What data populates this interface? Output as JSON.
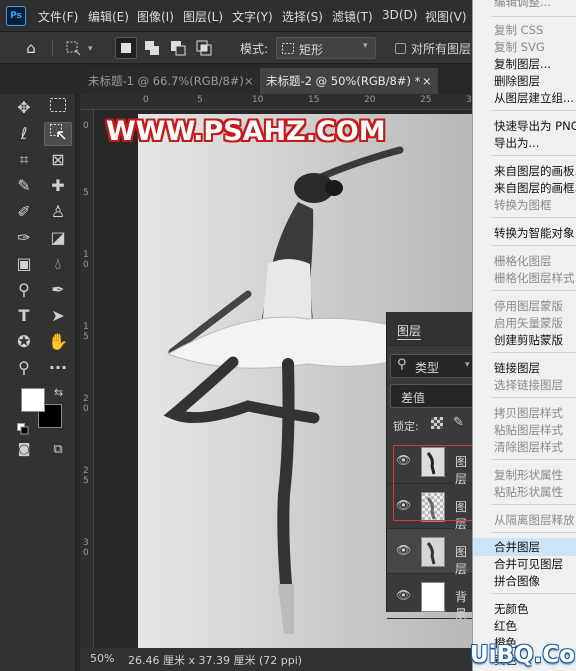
{
  "app": {
    "logo": "Ps"
  },
  "menubar": [
    "文件(F)",
    "编辑(E)",
    "图像(I)",
    "图层(L)",
    "文字(Y)",
    "选择(S)",
    "滤镜(T)",
    "3D(D)",
    "视图(V)"
  ],
  "options": {
    "mode_label": "模式:",
    "mode_value": "矩形",
    "align_label": "对所有图层"
  },
  "tabs": [
    {
      "label": "未标题-1 @ 66.7%(RGB/8#)"
    },
    {
      "label": "未标题-2 @ 50%(RGB/8#) *"
    }
  ],
  "watermark": "WWW.PSAHZ.COM",
  "ruler_h": [
    "0",
    "5",
    "10",
    "15",
    "20",
    "25",
    "3"
  ],
  "ruler_v": [
    "0",
    "5",
    "1\n0",
    "1\n5",
    "2\n0",
    "2\n5",
    "3\n0"
  ],
  "status": {
    "zoom": "50%",
    "info": "26.46 厘米 x 37.39 厘米 (72 ppi)"
  },
  "layers": {
    "title": "图层",
    "filter": "类型",
    "blend": "差值",
    "lock_label": "锁定:",
    "rows": [
      "图层",
      "图层",
      "图层",
      "背景"
    ]
  },
  "context_menu": {
    "items": [
      {
        "label": "编辑调整...",
        "disabled": true
      },
      {
        "label": "复制 CSS",
        "disabled": true
      },
      {
        "label": "复制 SVG",
        "disabled": true
      },
      {
        "label": "复制图层...",
        "disabled": false
      },
      {
        "label": "删除图层",
        "disabled": false
      },
      {
        "label": "从图层建立组...",
        "disabled": false
      },
      {
        "label": "快速导出为 PNG",
        "disabled": false
      },
      {
        "label": "导出为...",
        "disabled": false
      },
      {
        "label": "来自图层的画板...",
        "disabled": false
      },
      {
        "label": "来自图层的画框...",
        "disabled": false
      },
      {
        "label": "转换为图框",
        "disabled": true
      },
      {
        "label": "转换为智能对象",
        "disabled": false
      },
      {
        "label": "栅格化图层",
        "disabled": true
      },
      {
        "label": "栅格化图层样式",
        "disabled": true
      },
      {
        "label": "停用图层蒙版",
        "disabled": true
      },
      {
        "label": "启用矢量蒙版",
        "disabled": true
      },
      {
        "label": "创建剪贴蒙版",
        "disabled": false
      },
      {
        "label": "链接图层",
        "disabled": false
      },
      {
        "label": "选择链接图层",
        "disabled": true
      },
      {
        "label": "拷贝图层样式",
        "disabled": true
      },
      {
        "label": "粘贴图层样式",
        "disabled": true
      },
      {
        "label": "清除图层样式",
        "disabled": true
      },
      {
        "label": "复制形状属性",
        "disabled": true
      },
      {
        "label": "粘贴形状属性",
        "disabled": true
      },
      {
        "label": "从隔离图层释放",
        "disabled": true
      },
      {
        "label": "合并图层",
        "disabled": false
      },
      {
        "label": "合并可见图层",
        "disabled": false
      },
      {
        "label": "拼合图像",
        "disabled": false
      },
      {
        "label": "无颜色",
        "disabled": false
      },
      {
        "label": "红色",
        "disabled": false
      },
      {
        "label": "橙色",
        "disabled": false
      },
      {
        "label": "黄色",
        "disabled": false
      }
    ]
  },
  "footer_watermark": "UiBQ.CoM"
}
